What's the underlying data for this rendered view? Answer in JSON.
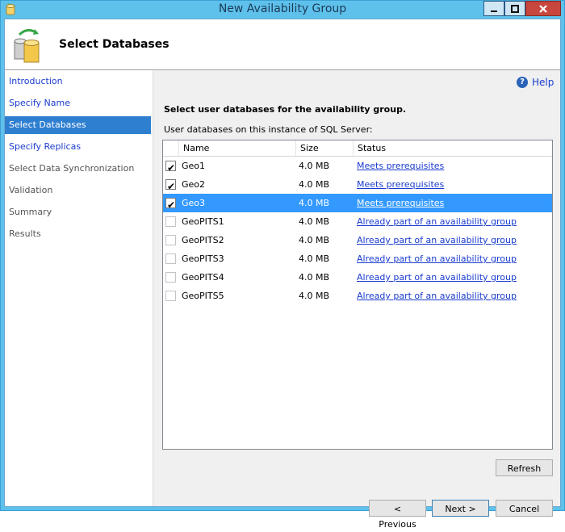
{
  "window": {
    "title": "New Availability Group"
  },
  "header": {
    "title": "Select Databases"
  },
  "nav": {
    "items": [
      {
        "label": "Introduction",
        "state": "link"
      },
      {
        "label": "Specify Name",
        "state": "link"
      },
      {
        "label": "Select Databases",
        "state": "active"
      },
      {
        "label": "Specify Replicas",
        "state": "link"
      },
      {
        "label": "Select Data Synchronization",
        "state": "plain"
      },
      {
        "label": "Validation",
        "state": "plain"
      },
      {
        "label": "Summary",
        "state": "plain"
      },
      {
        "label": "Results",
        "state": "plain"
      }
    ]
  },
  "content": {
    "help_label": "Help",
    "help_glyph": "?",
    "heading": "Select user databases for the availability group.",
    "subheading": "User databases on this instance of SQL Server:"
  },
  "table": {
    "columns": {
      "name": "Name",
      "size": "Size",
      "status": "Status"
    },
    "rows": [
      {
        "checked": true,
        "enabled": true,
        "selected": false,
        "name": "Geo1",
        "size": "4.0 MB",
        "status": "Meets prerequisites"
      },
      {
        "checked": true,
        "enabled": true,
        "selected": false,
        "name": "Geo2",
        "size": "4.0 MB",
        "status": "Meets prerequisites"
      },
      {
        "checked": true,
        "enabled": true,
        "selected": true,
        "name": "Geo3",
        "size": "4.0 MB",
        "status": "Meets prerequisites"
      },
      {
        "checked": false,
        "enabled": false,
        "selected": false,
        "name": "GeoPITS1",
        "size": "4.0 MB",
        "status": "Already part of an availability group"
      },
      {
        "checked": false,
        "enabled": false,
        "selected": false,
        "name": "GeoPITS2",
        "size": "4.0 MB",
        "status": "Already part of an availability group"
      },
      {
        "checked": false,
        "enabled": false,
        "selected": false,
        "name": "GeoPITS3",
        "size": "4.0 MB",
        "status": "Already part of an availability group"
      },
      {
        "checked": false,
        "enabled": false,
        "selected": false,
        "name": "GeoPITS4",
        "size": "4.0 MB",
        "status": "Already part of an availability group"
      },
      {
        "checked": false,
        "enabled": false,
        "selected": false,
        "name": "GeoPITS5",
        "size": "4.0 MB",
        "status": "Already part of an availability group"
      }
    ]
  },
  "buttons": {
    "refresh": "Refresh",
    "previous": "< Previous",
    "next": "Next >",
    "cancel": "Cancel"
  },
  "colors": {
    "titlebar": "#5ec1ec",
    "nav_active": "#2f7fd1",
    "row_selected": "#3399ff",
    "link": "#1a3ccf",
    "close_button": "#c7463e"
  },
  "icons": {
    "app": "wizard-app-icon",
    "header": "database-sync-icon",
    "help": "help-icon",
    "minimize": "minimize-icon",
    "maximize": "maximize-icon",
    "close": "close-icon",
    "check": "check-icon"
  }
}
